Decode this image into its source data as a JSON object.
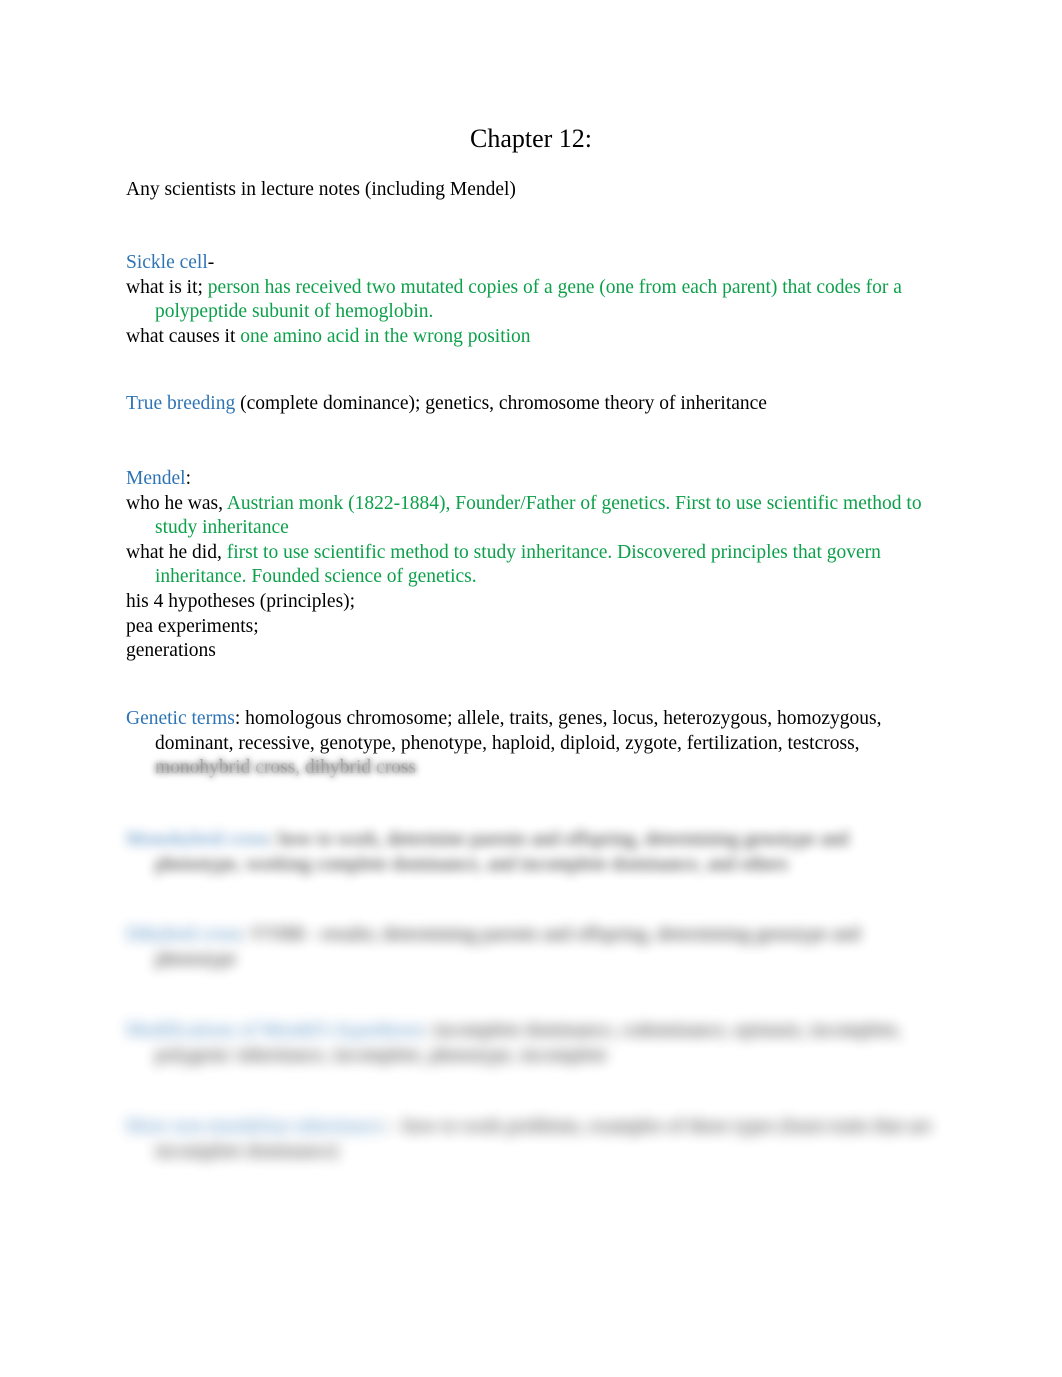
{
  "document": {
    "title": "Chapter 12:",
    "background_color": "#ffffff",
    "heading_color": "#2E74B5",
    "answer_color": "#0CA04A",
    "body_color": "#000000"
  },
  "intro": {
    "line": "Any scientists in lecture notes (including Mendel)"
  },
  "sections": [
    {
      "heading": "Sickle cell",
      "heading_suffix": "-",
      "lines": [
        {
          "prompt": "what is it;",
          "answer": " person has received two mutated copies of a gene (one from each parent) that codes for a polypeptide subunit of hemoglobin."
        },
        {
          "prompt": "what causes it",
          "answer": " one amino acid in the wrong position"
        }
      ]
    },
    {
      "heading": "True breeding",
      "heading_suffix": "",
      "trailing": " (complete dominance); genetics, chromosome theory of inheritance"
    },
    {
      "heading": "Mendel",
      "heading_suffix": ":",
      "lines": [
        {
          "prompt": "who he was,",
          "answer": " Austrian monk (1822-1884), Founder/Father of genetics. First to use scientific method to study inheritance"
        },
        {
          "prompt": "what he did,",
          "answer": " first to use scientific method to study inheritance. Discovered principles that govern inheritance. Founded science of genetics."
        }
      ],
      "plain_lines": [
        "his 4 hypotheses (principles);",
        "pea experiments;",
        "generations"
      ]
    },
    {
      "heading": "Genetic terms",
      "heading_suffix": ":",
      "trailing": " homologous chromosome; allele, traits, genes, locus, heterozygous, homozygous, dominant, recessive, genotype, phenotype, haploid, diploid, zygote, fertilization, testcross, monohybrid cross, dihybrid cross"
    }
  ],
  "obscured_sections": [
    {
      "heading": "Monohybrid cross",
      "body": ": how to work, determine parents and offspring, determining genotype and phenotype, working complete dominance, and incomplete dominance, and others"
    },
    {
      "heading": "Dihybrid cross",
      "body": ": YYRR - results; determining parents and offspring, determining genotype and phenotype"
    },
    {
      "heading": "Modifications of Mendel's hypotheses",
      "body": ": incomplete dominance, codominance, epistasis, incomplete, polygenic inheritance, incomplete, phenotype, incomplete"
    },
    {
      "heading": "More non-mendelian inheritance",
      "body": ": - how to work problems, examples of these types (learn traits that are incomplete dominance)"
    }
  ]
}
